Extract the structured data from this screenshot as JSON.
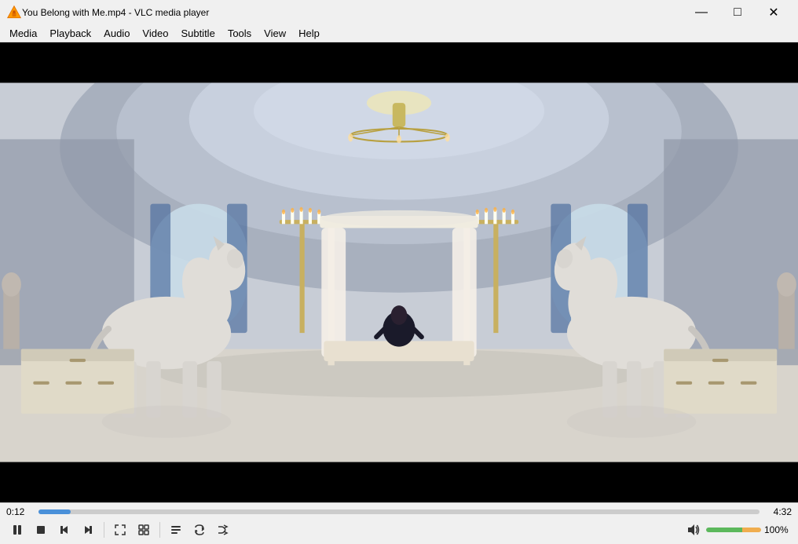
{
  "titlebar": {
    "title": "You Belong with Me.mp4 - VLC media player",
    "min_label": "—",
    "max_label": "□",
    "close_label": "✕"
  },
  "menubar": {
    "items": [
      "Media",
      "Playback",
      "Audio",
      "Video",
      "Subtitle",
      "Tools",
      "View",
      "Help"
    ]
  },
  "controls": {
    "time_current": "0:12",
    "time_total": "4:32",
    "progress_percent": 4.5,
    "volume_percent": "100%"
  },
  "buttons": {
    "play_pause": "⏸",
    "stop": "⏹",
    "prev": "⏮",
    "next": "⏭",
    "fullscreen": "⛶",
    "extended": "⧉",
    "playlist": "☰",
    "loop": "↻",
    "random": "⇄",
    "mute": "🔊"
  }
}
